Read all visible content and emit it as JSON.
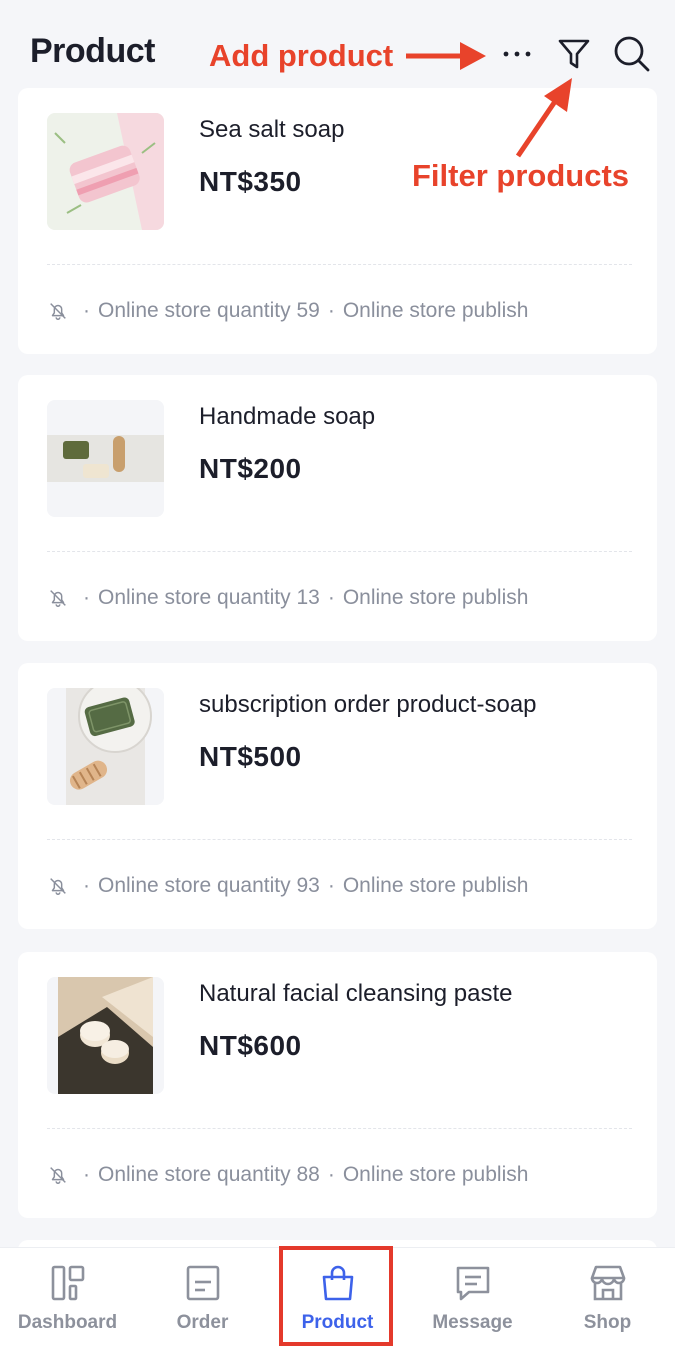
{
  "header": {
    "title": "Product",
    "more_icon": "more-horizontal-icon",
    "filter_icon": "funnel-filter-icon",
    "search_icon": "magnifier-search-icon"
  },
  "annotations": {
    "add_product": "Add product",
    "filter_products": "Filter products",
    "color": "#e8432b"
  },
  "products": [
    {
      "name": "Sea salt soap",
      "price": "NT$350",
      "quantity_text": "Online store quantity 59",
      "publish_text": "Online store publish",
      "image": "pink-soap-bar"
    },
    {
      "name": "Handmade soap",
      "price": "NT$200",
      "quantity_text": "Online store quantity 13",
      "publish_text": "Online store publish",
      "image": "green-soap-and-brush"
    },
    {
      "name": "subscription order product-soap",
      "price": "NT$500",
      "quantity_text": "Online store quantity 93",
      "publish_text": "Online store publish",
      "image": "green-soap-on-plate"
    },
    {
      "name": "Natural facial cleansing paste",
      "price": "NT$600",
      "quantity_text": "Online store quantity 88",
      "publish_text": "Online store publish",
      "image": "cream-jars"
    }
  ],
  "meta": {
    "separator": "·",
    "notification_icon": "bell-off-icon"
  },
  "bottom_nav": {
    "items": [
      {
        "label": "Dashboard",
        "icon": "dashboard-icon",
        "active": false
      },
      {
        "label": "Order",
        "icon": "order-icon",
        "active": false
      },
      {
        "label": "Product",
        "icon": "shopping-bag-icon",
        "active": true
      },
      {
        "label": "Message",
        "icon": "message-icon",
        "active": false
      },
      {
        "label": "Shop",
        "icon": "shop-icon",
        "active": false
      }
    ]
  },
  "colors": {
    "accent": "#3d62ea",
    "annotation": "#e8432b",
    "muted_text": "#8a8f9c",
    "background": "#f5f6f9"
  }
}
